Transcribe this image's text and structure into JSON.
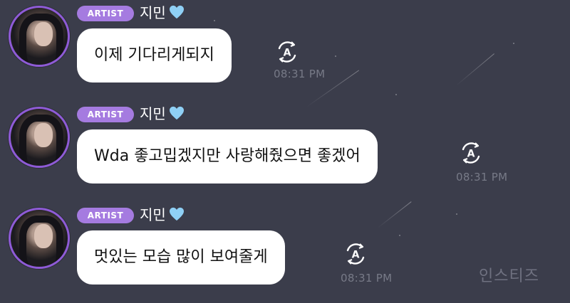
{
  "messages": [
    {
      "badge": "ARTIST",
      "name": "지민",
      "text": "이제 기다리게되지",
      "time": "08:31 PM",
      "heart_icon": "light-blue-heart-icon",
      "translate_icon": "translate-icon"
    },
    {
      "badge": "ARTIST",
      "name": "지민",
      "text": "Wda 좋고밉겠지만 사랑해줬으면 좋겠어",
      "time": "08:31 PM",
      "heart_icon": "light-blue-heart-icon",
      "translate_icon": "translate-icon"
    },
    {
      "badge": "ARTIST",
      "name": "지민",
      "text": "멋있는 모습 많이 보여줄게",
      "time": "08:31 PM",
      "heart_icon": "light-blue-heart-icon",
      "translate_icon": "translate-icon"
    }
  ],
  "watermark": "인스티즈",
  "colors": {
    "background": "#3b3d4b",
    "badge": "#a57be0",
    "avatar_ring": "#8e5bd6",
    "heart": "#8fd0f5",
    "bubble": "#ffffff",
    "timestamp": "#777a87"
  }
}
